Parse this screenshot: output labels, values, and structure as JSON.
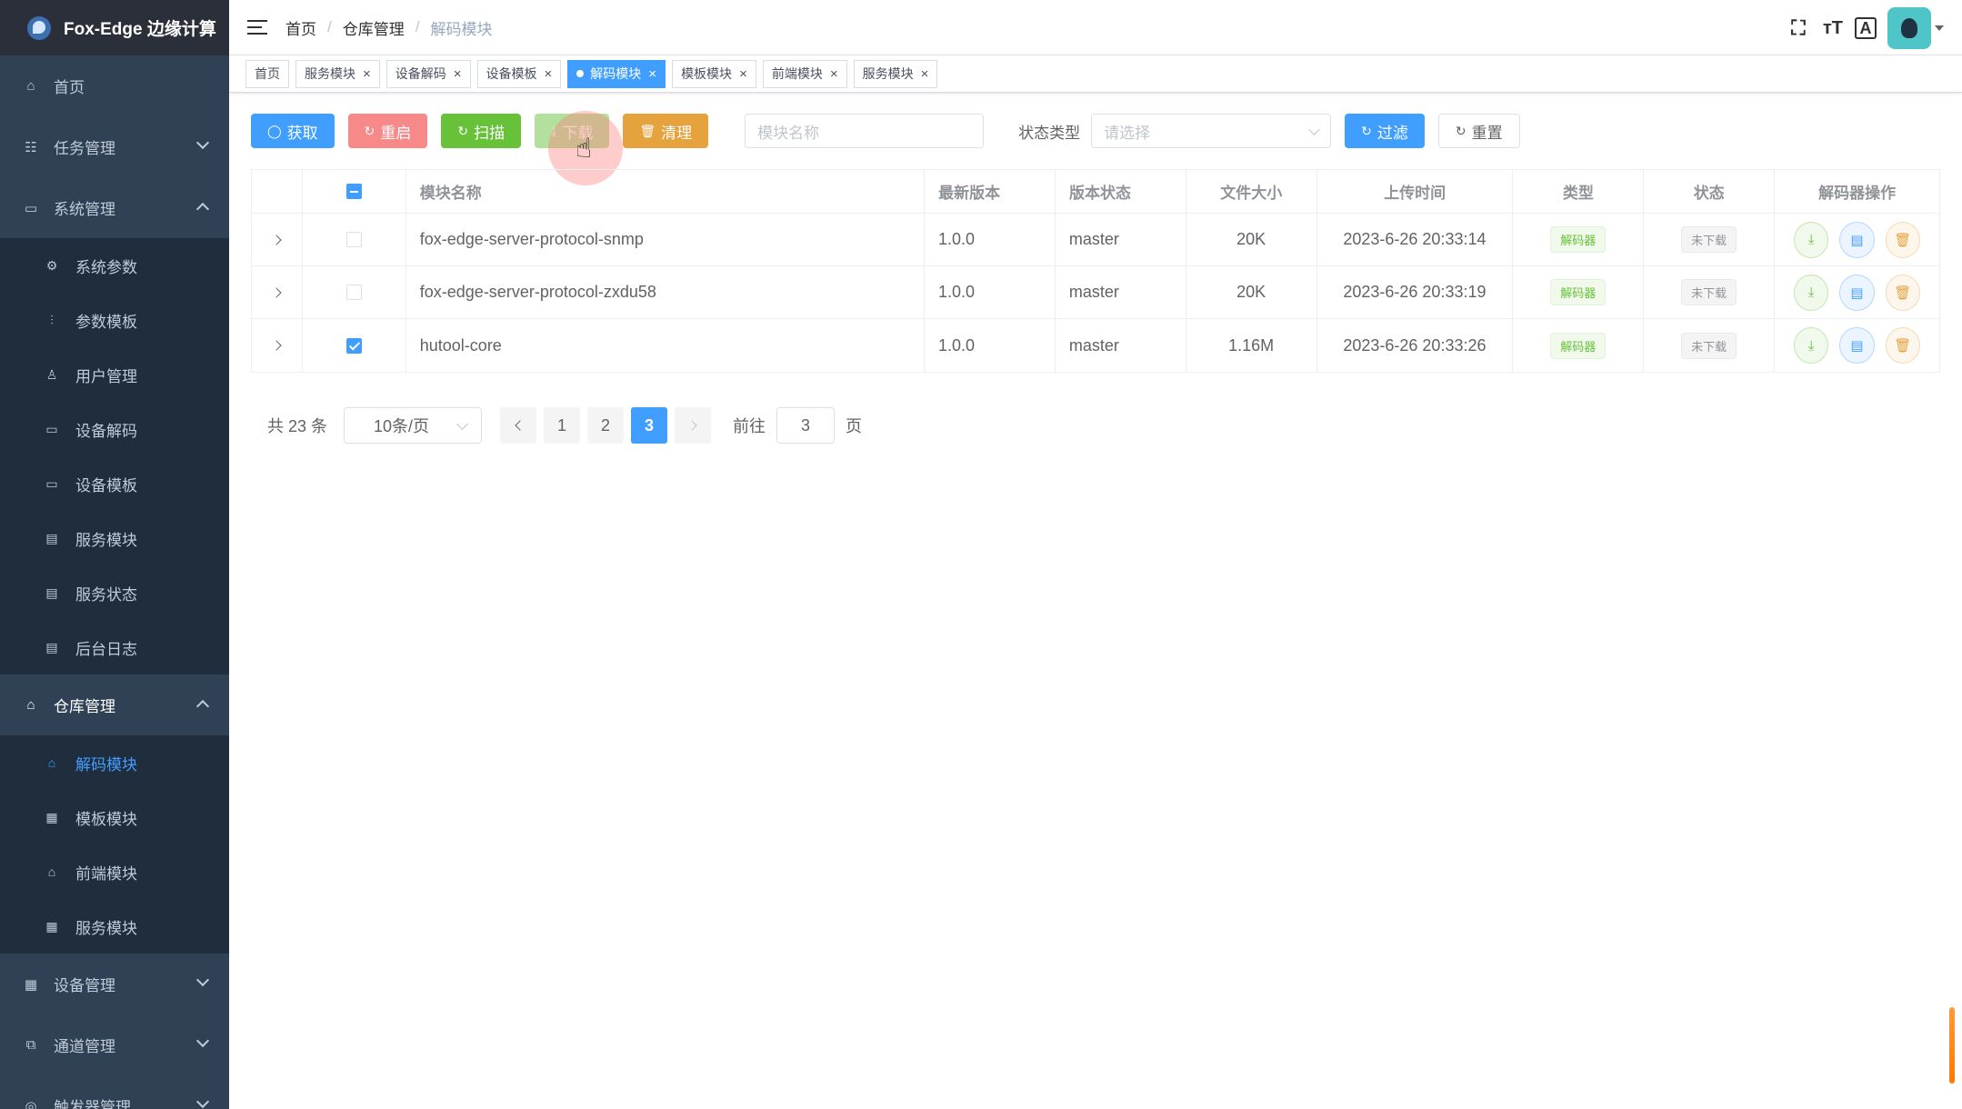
{
  "app": {
    "title": "Fox-Edge 边缘计算"
  },
  "sidebar": {
    "items": [
      {
        "label": "首页",
        "icon": "home-icon"
      },
      {
        "label": "任务管理",
        "icon": "task-icon"
      },
      {
        "label": "系统管理",
        "icon": "system-icon"
      },
      {
        "label": "系统参数",
        "icon": "gear-icon"
      },
      {
        "label": "参数模板",
        "icon": "sliders-icon"
      },
      {
        "label": "用户管理",
        "icon": "user-icon"
      },
      {
        "label": "设备解码",
        "icon": "device-icon"
      },
      {
        "label": "设备模板",
        "icon": "device-icon"
      },
      {
        "label": "服务模块",
        "icon": "module-icon"
      },
      {
        "label": "服务状态",
        "icon": "module-icon"
      },
      {
        "label": "后台日志",
        "icon": "module-icon"
      },
      {
        "label": "仓库管理",
        "icon": "warehouse-icon"
      },
      {
        "label": "解码模块",
        "icon": "warehouse-icon"
      },
      {
        "label": "模板模块",
        "icon": "template-icon"
      },
      {
        "label": "前端模块",
        "icon": "warehouse-icon"
      },
      {
        "label": "服务模块",
        "icon": "template-icon"
      },
      {
        "label": "设备管理",
        "icon": "grid-icon"
      },
      {
        "label": "通道管理",
        "icon": "channel-icon"
      },
      {
        "label": "触发器管理",
        "icon": "trigger-icon"
      }
    ]
  },
  "breadcrumb": [
    "首页",
    "仓库管理",
    "解码模块"
  ],
  "tags": [
    "首页",
    "服务模块",
    "设备解码",
    "设备模板",
    "解码模块",
    "模板模块",
    "前端模块",
    "服务模块"
  ],
  "toolbar": {
    "fetch": "获取",
    "restart": "重启",
    "scan": "扫描",
    "download": "下载",
    "clean": "清理",
    "name_placeholder": "模块名称",
    "status_type_label": "状态类型",
    "status_placeholder": "请选择",
    "filter": "过滤",
    "reset": "重置"
  },
  "table": {
    "headers": [
      "模块名称",
      "最新版本",
      "版本状态",
      "文件大小",
      "上传时间",
      "类型",
      "状态",
      "解码器操作"
    ],
    "rows": [
      {
        "name": "fox-edge-server-protocol-snmp",
        "version": "1.0.0",
        "version_status": "master",
        "size": "20K",
        "upload_time": "2023-6-26 20:33:14",
        "type": "解码器",
        "status": "未下载",
        "checked": false
      },
      {
        "name": "fox-edge-server-protocol-zxdu58",
        "version": "1.0.0",
        "version_status": "master",
        "size": "20K",
        "upload_time": "2023-6-26 20:33:19",
        "type": "解码器",
        "status": "未下载",
        "checked": false
      },
      {
        "name": "hutool-core",
        "version": "1.0.0",
        "version_status": "master",
        "size": "1.16M",
        "upload_time": "2023-6-26 20:33:26",
        "type": "解码器",
        "status": "未下载",
        "checked": true
      }
    ]
  },
  "pagination": {
    "total": "共 23 条",
    "page_size": "10条/页",
    "pages": [
      "1",
      "2",
      "3"
    ],
    "current": "3",
    "goto_label": "前往",
    "goto_value": "3",
    "page_suffix": "页"
  },
  "colors": {
    "primary": "#409eff",
    "sidebar": "#304156",
    "success": "#67c23a",
    "warning": "#e6a23c",
    "danger": "#f78989"
  }
}
